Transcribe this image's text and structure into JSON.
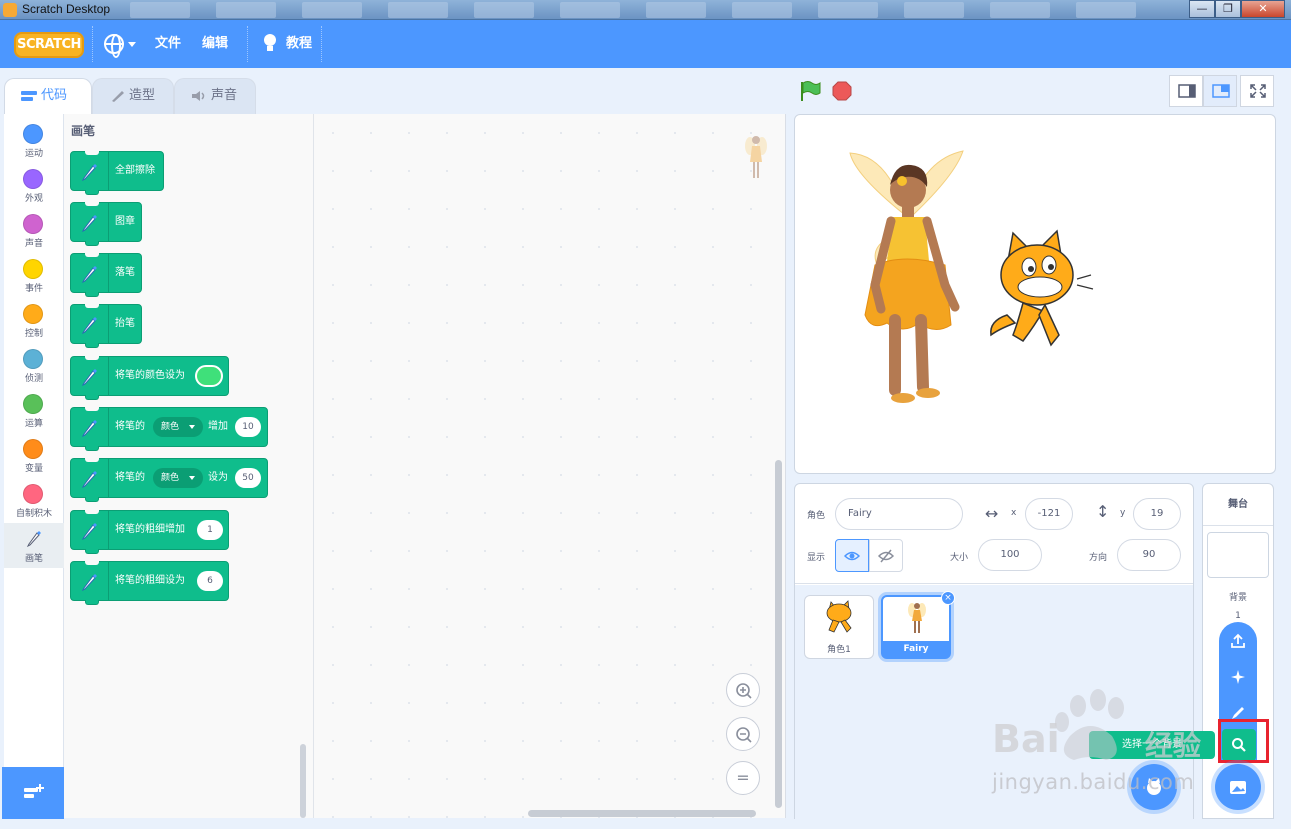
{
  "window": {
    "title": "Scratch Desktop",
    "controls": [
      "—",
      "❐",
      "✕"
    ]
  },
  "menubar": {
    "logo": "SCRATCH",
    "file": "文件",
    "edit": "编辑",
    "tutorials": "教程"
  },
  "tabs": [
    {
      "label": "代码",
      "icon": "code-icon"
    },
    {
      "label": "造型",
      "icon": "brush-icon"
    },
    {
      "label": "声音",
      "icon": "speaker-icon"
    }
  ],
  "categories": [
    {
      "label": "运动",
      "color": "#4c97ff"
    },
    {
      "label": "外观",
      "color": "#9966ff"
    },
    {
      "label": "声音",
      "color": "#cf63cf"
    },
    {
      "label": "事件",
      "color": "#ffd500"
    },
    {
      "label": "控制",
      "color": "#ffab19"
    },
    {
      "label": "侦测",
      "color": "#5cb1d6"
    },
    {
      "label": "运算",
      "color": "#59c059"
    },
    {
      "label": "变量",
      "color": "#ff8c1a"
    },
    {
      "label": "自制积木",
      "color": "#ff6680"
    },
    {
      "label": "画笔",
      "icon": "pen-icon",
      "selected": true
    }
  ],
  "palette": {
    "title": "画笔",
    "blocks": [
      {
        "text": "全部擦除"
      },
      {
        "text": "图章"
      },
      {
        "text": "落笔"
      },
      {
        "text": "抬笔"
      },
      {
        "text": "将笔的颜色设为",
        "color_value": "#3fe07a"
      },
      {
        "prefix": "将笔的",
        "dropdown": "颜色",
        "middle": "增加",
        "value": "10"
      },
      {
        "prefix": "将笔的",
        "dropdown": "颜色",
        "middle": "设为",
        "value": "50"
      },
      {
        "text": "将笔的粗细增加",
        "value": "1"
      },
      {
        "text": "将笔的粗细设为",
        "value": "6"
      }
    ]
  },
  "zoom": {
    "in": "zoom-in-icon",
    "out": "zoom-out-icon",
    "reset": "="
  },
  "sprite_info": {
    "sprite_label": "角色",
    "sprite_name": "Fairy",
    "x_label": "x",
    "x_value": "-121",
    "y_label": "y",
    "y_value": "19",
    "show_label": "显示",
    "size_label": "大小",
    "size_value": "100",
    "direction_label": "方向",
    "direction_value": "90"
  },
  "sprites": [
    {
      "name": "角色1",
      "selected": false
    },
    {
      "name": "Fairy",
      "selected": true
    }
  ],
  "stage_selector": {
    "title": "舞台",
    "backdrops_label": "背景",
    "backdrops_count": "1",
    "tooltip": "选择一个背景"
  },
  "watermark": {
    "brand": "Bai",
    "sub": "经验",
    "url": "jingyan.baidu.com"
  },
  "colors": {
    "accent": "#4c97ff",
    "pen": "#0fbd8c",
    "highlight": "#e8232f"
  }
}
